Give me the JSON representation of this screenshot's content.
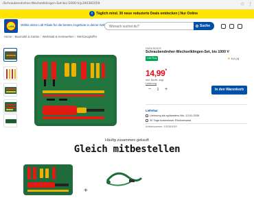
{
  "browser": {
    "url": "/Schraubendreher-Wechselklingen-Set-bis-1000-V/p100381059"
  },
  "promo": {
    "icon": "info-icon",
    "text": "Täglich mind. 30 neue reduzierte Deals entdecken | Nur Online"
  },
  "header": {
    "logo_text": "LIDL",
    "store_link": "Wähle deine Lidl-Filiale für die besten Angebote in deiner Nähe",
    "search_placeholder": "Wonach suchst du?",
    "search_button": "Suche"
  },
  "breadcrumb": [
    "Home",
    "Baumarkt & Garten",
    "Werkstatt & Heimwerken",
    "Werkzeugkoffer"
  ],
  "product": {
    "article_number_top": "PARKSIDE®",
    "title": "Schraubendreher-Wechselklingen-Set, bis 1000 V",
    "badge": "Lidl Plus",
    "rating_value": "5,0",
    "rating_count": "(4)",
    "price": "14,99",
    "price_star": "*",
    "price_note_1": "inkl. MwSt. zzgl.",
    "price_note_2": "Lieferung",
    "qty": "1",
    "qty_minus": "−",
    "qty_plus": "+",
    "cart_button": "In den Warenkorb"
  },
  "delivery": {
    "title": "Lieferbar",
    "line1": "Lieferung bis spätestens Mo, 13.01.2026",
    "line2": "30 Tage kostenloser Rückversand",
    "article_no": "Artikelnummer: 100381059"
  },
  "bottom": {
    "freq": "Häufig zusammen gekauft",
    "headline": "Gleich mitbestellen",
    "plus": "+"
  }
}
